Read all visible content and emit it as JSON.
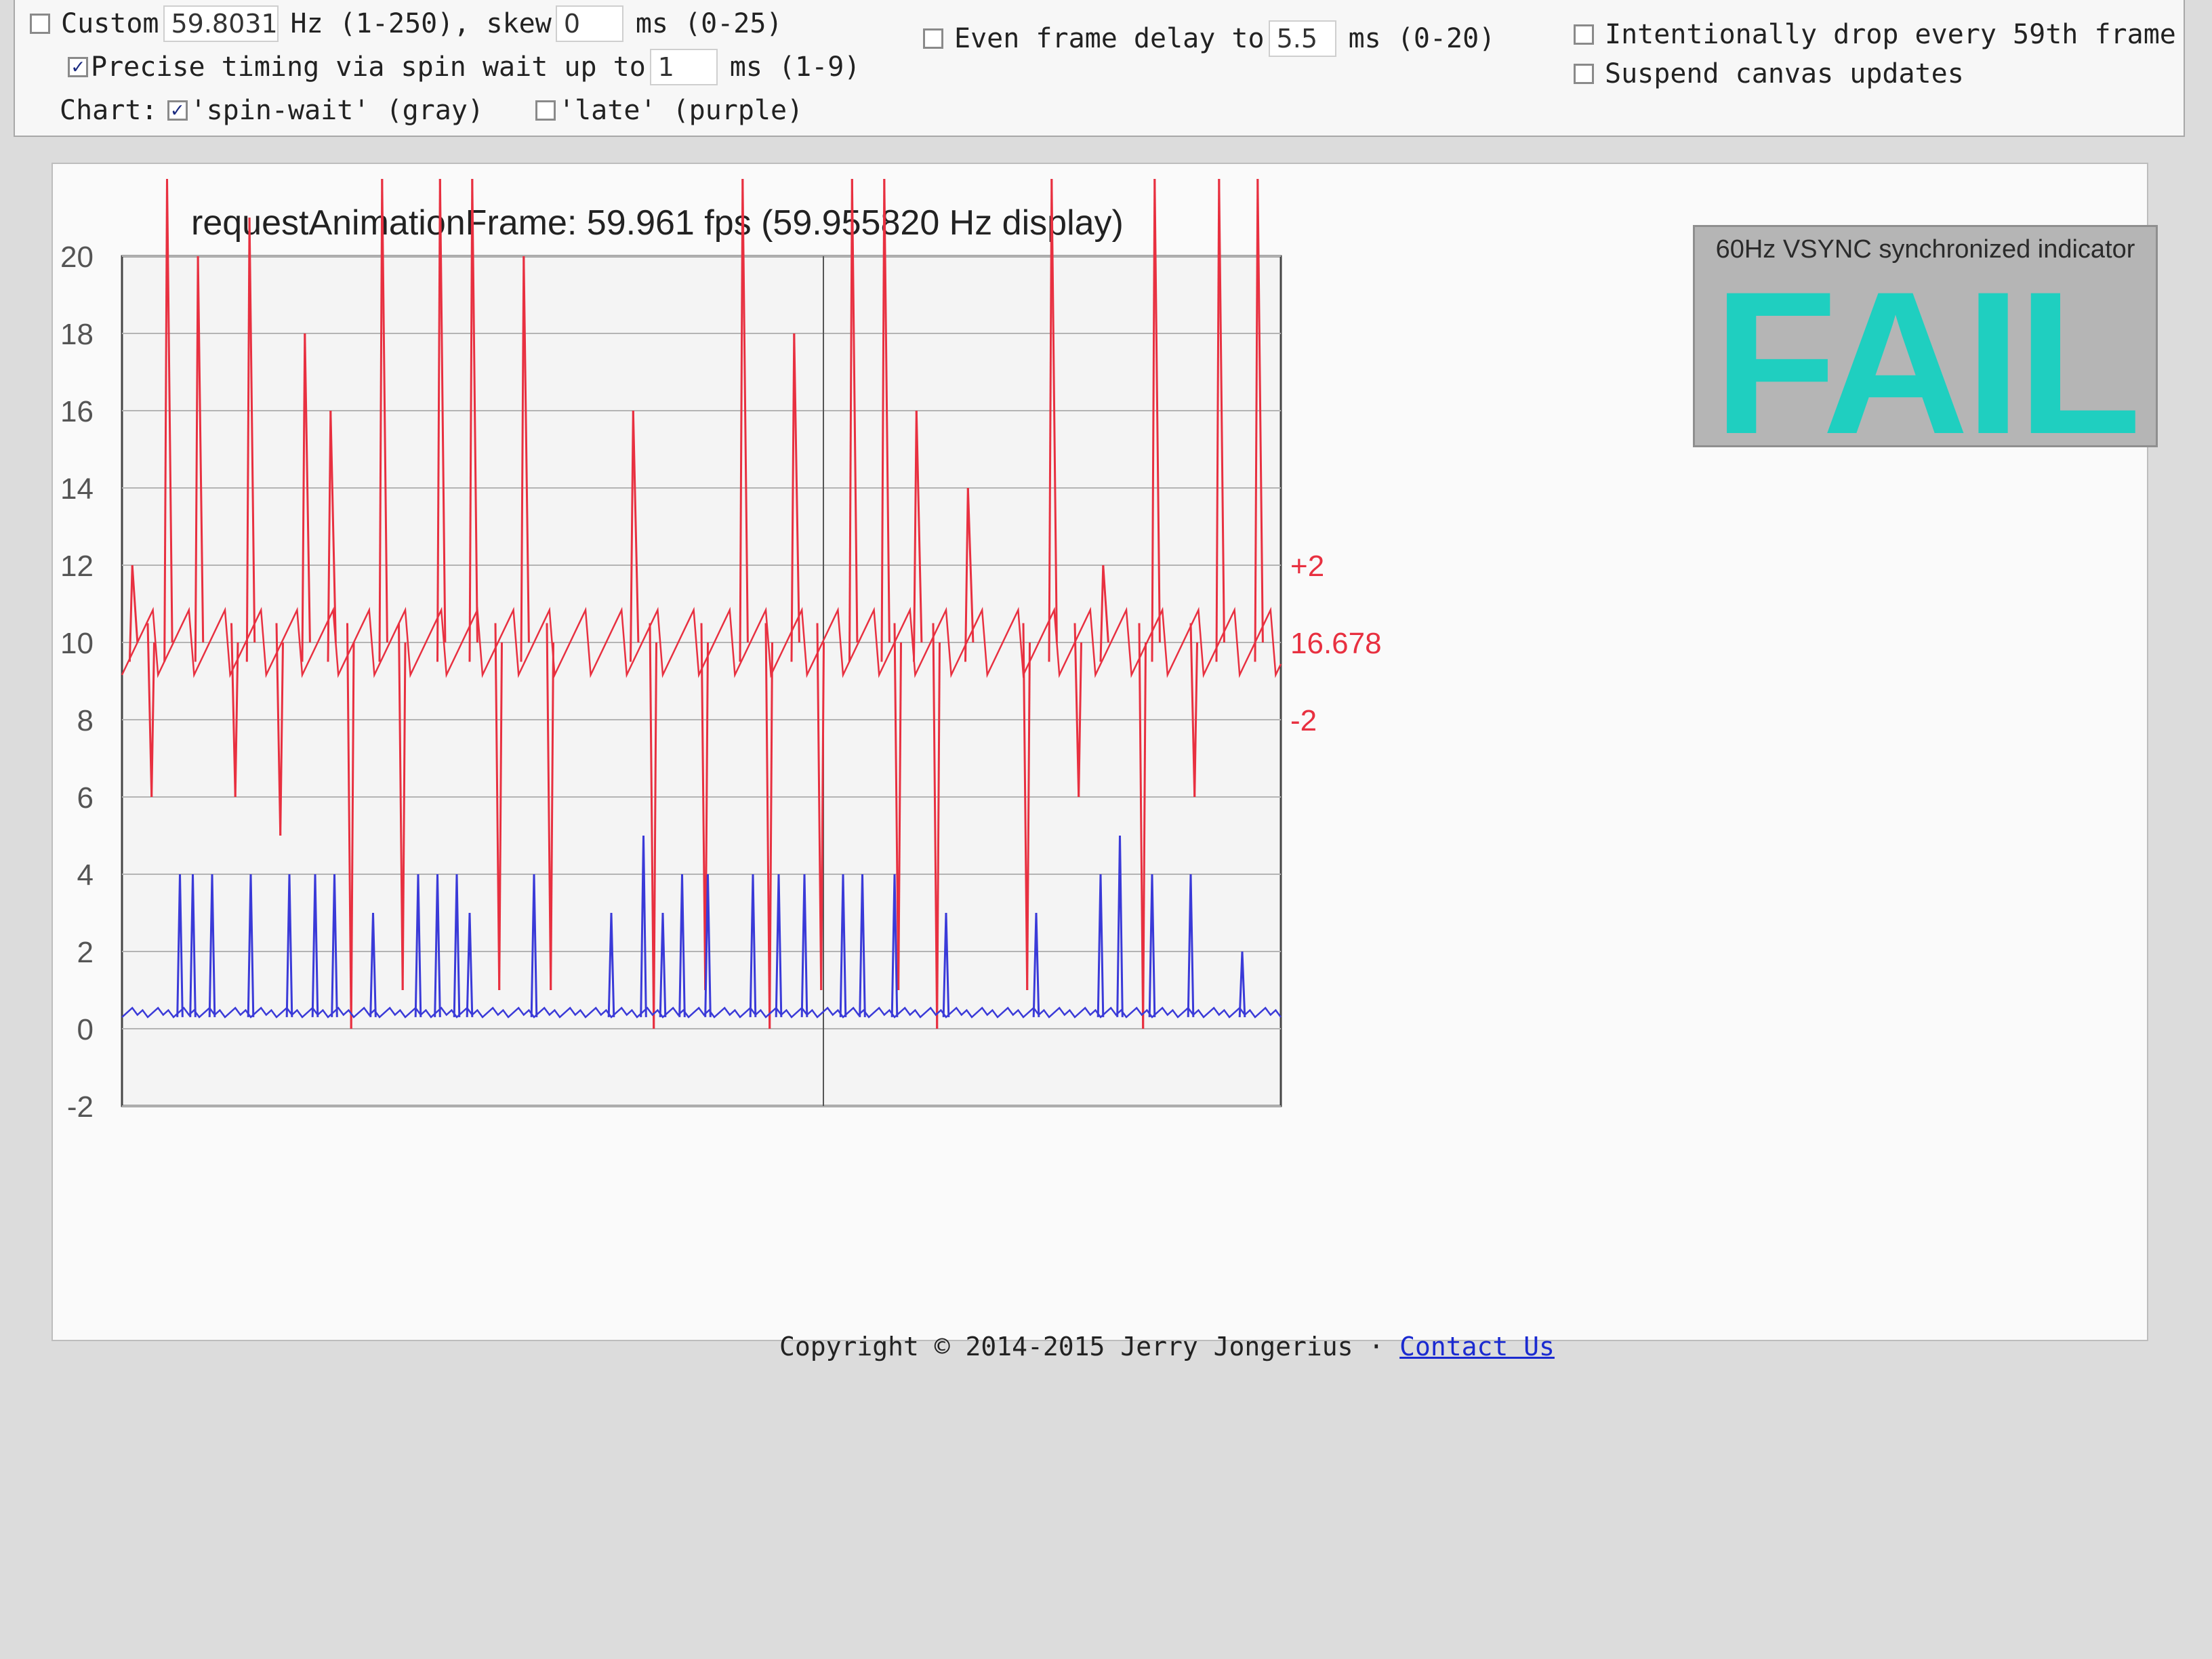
{
  "controls": {
    "custom_label": "Custom",
    "custom_value": "59.8031",
    "hz_range": "Hz (1-250), skew",
    "skew_value": "0",
    "skew_range": "ms (0-25)",
    "spin_label": "Precise timing via spin wait up to",
    "spin_value": "1",
    "spin_range": "ms (1-9)",
    "chart_label": "Chart:",
    "spinwait_label": "'spin-wait' (gray)",
    "late_label": "'late' (purple)",
    "even_label": "Even frame delay to",
    "even_value": "5.5",
    "even_range": "ms (0-20)",
    "drop_label": "Intentionally drop every 59th frame",
    "suspend_label": "Suspend canvas updates",
    "custom_checked": false,
    "spin_checked": true,
    "spinwait_checked": true,
    "late_checked": false,
    "even_checked": false,
    "drop_checked": false,
    "suspend_checked": false
  },
  "vsync": {
    "title": "60Hz VSYNC synchronized indicator",
    "result": "FAIL",
    "result_color": "#1fcfc0"
  },
  "footer": {
    "copyright": "Copyright © 2014-2015 Jerry Jongerius ·",
    "contact": "Contact Us"
  },
  "chart_data": {
    "type": "line",
    "title": "requestAnimationFrame: 59.961 fps  (59.955820 Hz display)",
    "ylim": [
      -2,
      20
    ],
    "yticks": [
      20,
      18,
      16,
      14,
      12,
      10,
      8,
      6,
      4,
      2,
      0,
      -2
    ],
    "grid": true,
    "reference_labels": [
      "+2",
      "16.678",
      "-2"
    ],
    "reference_values": [
      12,
      10,
      8
    ],
    "colors": {
      "frame": "#e83040",
      "spinwait": "#3a3ad8"
    },
    "frame_spikes": [
      {
        "x": 6,
        "peak": 12
      },
      {
        "x": 33,
        "peak": 22
      },
      {
        "x": 57,
        "peak": 20
      },
      {
        "x": 97,
        "peak": 21
      },
      {
        "x": 140,
        "peak": 18
      },
      {
        "x": 160,
        "peak": 16
      },
      {
        "x": 200,
        "peak": 22
      },
      {
        "x": 245,
        "peak": 22
      },
      {
        "x": 270,
        "peak": 22
      },
      {
        "x": 310,
        "peak": 20
      },
      {
        "x": 395,
        "peak": 16
      },
      {
        "x": 480,
        "peak": 22
      },
      {
        "x": 520,
        "peak": 18
      },
      {
        "x": 565,
        "peak": 22
      },
      {
        "x": 590,
        "peak": 22
      },
      {
        "x": 615,
        "peak": 16
      },
      {
        "x": 655,
        "peak": 14
      },
      {
        "x": 720,
        "peak": 22
      },
      {
        "x": 760,
        "peak": 12
      },
      {
        "x": 800,
        "peak": 22
      },
      {
        "x": 850,
        "peak": 22
      },
      {
        "x": 880,
        "peak": 22
      }
    ],
    "frame_dips": [
      {
        "x": 20,
        "low": 6
      },
      {
        "x": 85,
        "low": 6
      },
      {
        "x": 120,
        "low": 5
      },
      {
        "x": 175,
        "low": 0
      },
      {
        "x": 215,
        "low": 1
      },
      {
        "x": 290,
        "low": 1
      },
      {
        "x": 330,
        "low": 1
      },
      {
        "x": 410,
        "low": 0
      },
      {
        "x": 450,
        "low": 1
      },
      {
        "x": 500,
        "low": 0
      },
      {
        "x": 540,
        "low": 1
      },
      {
        "x": 600,
        "low": 1
      },
      {
        "x": 630,
        "low": 0
      },
      {
        "x": 700,
        "low": 1
      },
      {
        "x": 740,
        "low": 6
      },
      {
        "x": 790,
        "low": 0
      },
      {
        "x": 830,
        "low": 6
      }
    ],
    "spinwait_spikes": [
      {
        "x": 45,
        "peak": 4
      },
      {
        "x": 55,
        "peak": 4
      },
      {
        "x": 70,
        "peak": 4
      },
      {
        "x": 100,
        "peak": 4
      },
      {
        "x": 130,
        "peak": 4
      },
      {
        "x": 150,
        "peak": 4
      },
      {
        "x": 165,
        "peak": 4
      },
      {
        "x": 195,
        "peak": 3
      },
      {
        "x": 230,
        "peak": 4
      },
      {
        "x": 245,
        "peak": 4
      },
      {
        "x": 260,
        "peak": 4
      },
      {
        "x": 270,
        "peak": 3
      },
      {
        "x": 320,
        "peak": 4
      },
      {
        "x": 380,
        "peak": 3
      },
      {
        "x": 405,
        "peak": 5
      },
      {
        "x": 420,
        "peak": 3
      },
      {
        "x": 435,
        "peak": 4
      },
      {
        "x": 455,
        "peak": 4
      },
      {
        "x": 490,
        "peak": 4
      },
      {
        "x": 510,
        "peak": 4
      },
      {
        "x": 530,
        "peak": 4
      },
      {
        "x": 560,
        "peak": 4
      },
      {
        "x": 575,
        "peak": 4
      },
      {
        "x": 600,
        "peak": 4
      },
      {
        "x": 640,
        "peak": 3
      },
      {
        "x": 710,
        "peak": 3
      },
      {
        "x": 760,
        "peak": 4
      },
      {
        "x": 775,
        "peak": 5
      },
      {
        "x": 800,
        "peak": 4
      },
      {
        "x": 830,
        "peak": 4
      },
      {
        "x": 870,
        "peak": 2
      }
    ]
  }
}
